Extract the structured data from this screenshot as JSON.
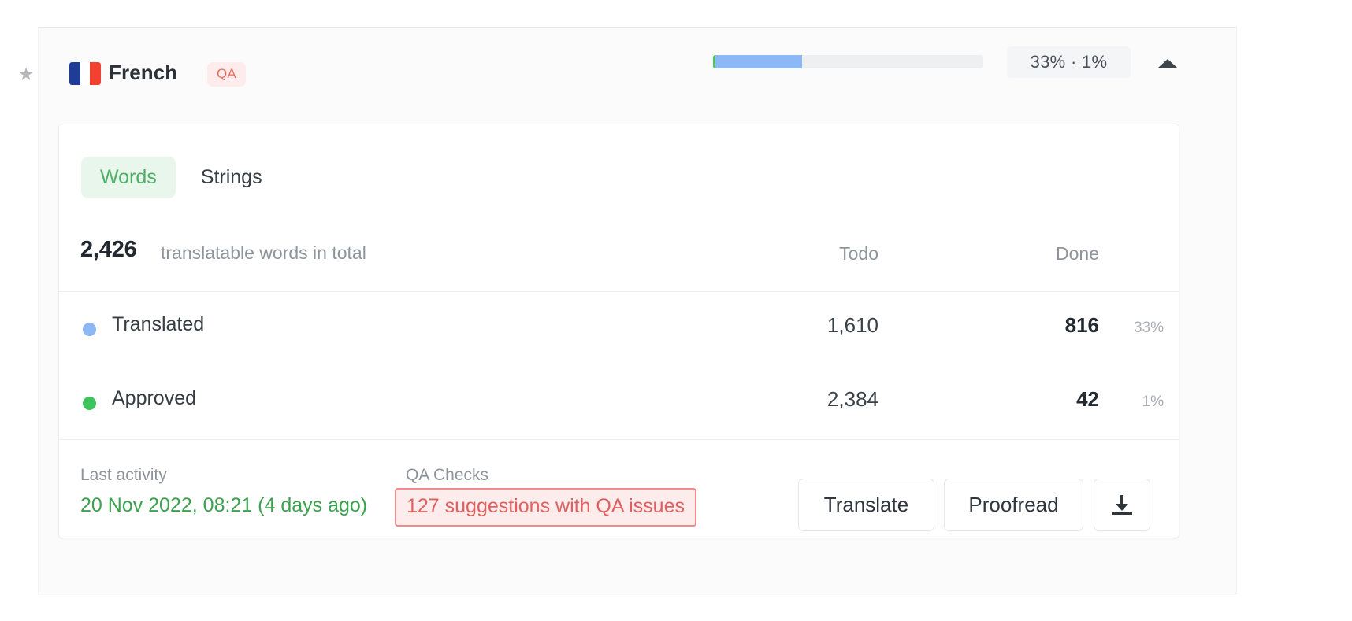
{
  "language_row": {
    "star_icon": "star-icon",
    "flag": "french-flag-icon",
    "name": "French",
    "qa_badge": "QA",
    "progress": {
      "approved_pct": 1,
      "translated_pct": 33,
      "track_color": "#eeeff0",
      "translated_color": "#8cb8f5",
      "approved_color": "#4bc35e"
    },
    "percent_badge": "33% · 1%",
    "collapse_icon": "chevron-up-icon"
  },
  "card": {
    "tabs": [
      {
        "label": "Words",
        "active": true
      },
      {
        "label": "Strings",
        "active": false
      }
    ],
    "totals": {
      "count": "2,426",
      "label": "translatable words in total",
      "columns": [
        "Todo",
        "Done"
      ]
    },
    "rows": [
      {
        "name": "Translated",
        "dot_color": "#8cb8f5",
        "todo": "1,610",
        "done": "816",
        "percent": "33%"
      },
      {
        "name": "Approved",
        "dot_color": "#3dc45c",
        "todo": "2,384",
        "done": "42",
        "percent": "1%"
      }
    ],
    "footer": {
      "last_activity_label": "Last activity",
      "last_activity_value": "20 Nov 2022, 08:21 (4 days ago)",
      "qa_checks_label": "QA Checks",
      "qa_checks_value": "127 suggestions with QA issues",
      "translate_button": "Translate",
      "proofread_button": "Proofread",
      "download_icon": "download-icon"
    }
  }
}
